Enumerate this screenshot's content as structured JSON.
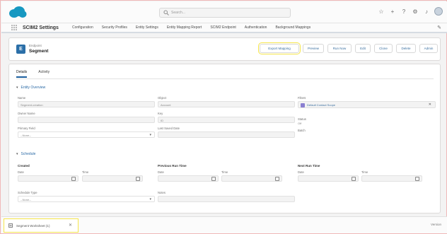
{
  "global_header": {
    "search_placeholder": "Search..."
  },
  "nav": {
    "app_name": "SCIM2 Settings",
    "items": [
      "Configuration",
      "Security Profiles",
      "Entity Settings",
      "Entity Mapping Report",
      "SCIM2 Endpoint",
      "Authentication",
      "Background Mappings"
    ]
  },
  "record": {
    "object_label": "Endpoint",
    "name": "Segment",
    "icon_letter": "E",
    "buttons": [
      "Export Mapping",
      "Preview",
      "Run Now",
      "Edit",
      "Clone",
      "Delete",
      "Admin"
    ]
  },
  "tabs": [
    "Details",
    "Activity"
  ],
  "sections": {
    "entity_overview": "Entity Overview",
    "schedule": "Schedule"
  },
  "fields": {
    "name_label": "Name",
    "name_value": "Segment-creation",
    "object_label": "Object",
    "object_value": "Account",
    "filters_label": "Filters",
    "filters_value": "Default Contact Scope",
    "owner_label": "Owner Name",
    "key_label": "Key",
    "key_value": "ID",
    "status_label": "Status",
    "status_value": "Off",
    "primary_field_label": "Primary Field",
    "primary_field_value": "--None--",
    "last_saved_label": "Last Saved Date",
    "batch_label": "Batch"
  },
  "schedule": {
    "created_label": "Created",
    "previous_label": "Previous Run Time",
    "next_label": "Next Run Time",
    "date_label": "Date",
    "time_label": "Time",
    "schedule_type_label": "Schedule Type",
    "schedule_type_value": "--None--",
    "notes_label": "Notes"
  },
  "footer": {
    "utility_label": "Segment Worksheet (1)",
    "version": "Version"
  }
}
